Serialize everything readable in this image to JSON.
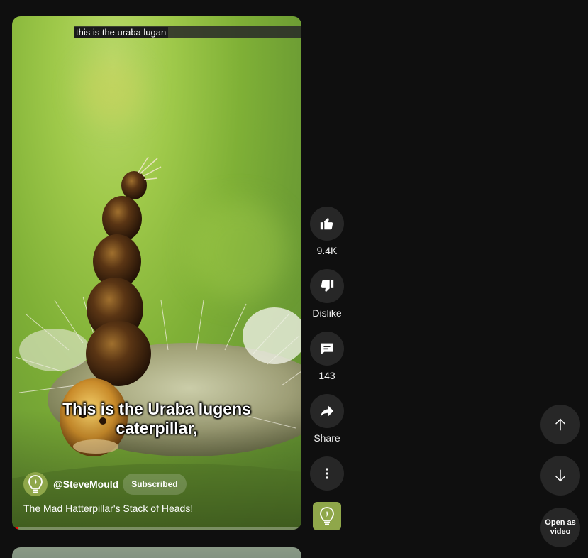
{
  "video": {
    "top_caption": "this is the uraba lugan",
    "subtitle_line1": "This is the Uraba lugens",
    "subtitle_line2": "caterpillar,",
    "channel_handle": "@SteveMould",
    "subscribe_state": "Subscribed",
    "title": "The Mad Hatterpillar's Stack of Heads!",
    "progress_fraction": 0.02
  },
  "actions": {
    "like_count": "9.4K",
    "dislike_label": "Dislike",
    "comment_count": "143",
    "share_label": "Share"
  },
  "navigation": {
    "open_as_video_label": "Open as video"
  },
  "icons": {
    "like": "thumbs-up-icon",
    "dislike": "thumbs-down-icon",
    "comments": "comment-icon",
    "share": "share-arrow-icon",
    "more": "more-vertical-icon",
    "previous": "arrow-up-icon",
    "next": "arrow-down-icon",
    "channel_logo": "lightbulb-icon"
  },
  "colors": {
    "background": "#0f0f0f",
    "button_bg": "#272727",
    "progress": "#ff0000",
    "channel_avatar": "#8fa74a"
  }
}
